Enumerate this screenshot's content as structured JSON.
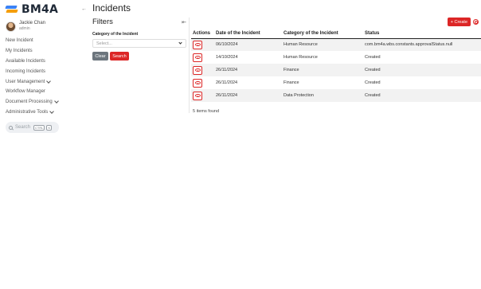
{
  "app": {
    "logo_text": "BM4A",
    "collapse_icon": "arrow-left-icon"
  },
  "user": {
    "name": "Jackie Chan",
    "role": "admin"
  },
  "nav": {
    "items": [
      {
        "label": "New Incident"
      },
      {
        "label": "My Incidents"
      },
      {
        "label": "Available Incidents"
      },
      {
        "label": "Incoming Incidents"
      },
      {
        "label": "User Management"
      },
      {
        "label": "Workflow Manager"
      },
      {
        "label": "Document Processing"
      },
      {
        "label": "Administrative Tools"
      }
    ]
  },
  "search": {
    "label": "Search",
    "kbd1": "CTRL",
    "kbd2": "K"
  },
  "page": {
    "title": "Incidents"
  },
  "filters": {
    "title": "Filters",
    "category_label": "Category of the Incident",
    "category_placeholder": "Select...",
    "clear_label": "Clear",
    "search_label": "Search"
  },
  "toolbar": {
    "create_label": "+ Create"
  },
  "table": {
    "headers": [
      "Actions",
      "Date of the Incident",
      "Category of the Incident",
      "Status"
    ],
    "rows": [
      {
        "date": "06/10/2024",
        "category": "Human Resource",
        "status": "com.bm4a.wbs.constants.approvalStatus.null"
      },
      {
        "date": "14/10/2024",
        "category": "Human Resource",
        "status": "Created"
      },
      {
        "date": "26/11/2024",
        "category": "Finance",
        "status": "Created"
      },
      {
        "date": "26/11/2024",
        "category": "Finance",
        "status": "Created"
      },
      {
        "date": "26/11/2024",
        "category": "Data Protection",
        "status": "Created"
      }
    ],
    "footer": "5 items found"
  },
  "colors": {
    "accent": "#dc2626",
    "secondary": "#6c757d",
    "stripe": "#f2f2f2"
  }
}
